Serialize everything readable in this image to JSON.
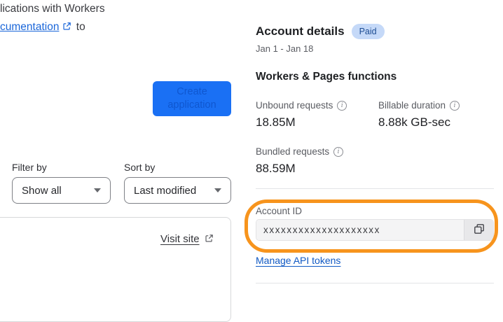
{
  "intro": {
    "line1": "lications with Workers",
    "doc_link_text": "cumentation",
    "line2_suffix": "to"
  },
  "create_button": {
    "label": "Create application"
  },
  "filters": {
    "filter_by_label": "Filter by",
    "filter_value": "Show all",
    "sort_by_label": "Sort by",
    "sort_value": "Last modified"
  },
  "card": {
    "visit_site_label": "Visit site"
  },
  "account": {
    "title": "Account details",
    "badge": "Paid",
    "date_range": "Jan 1 - Jan 18",
    "section_title": "Workers & Pages functions",
    "stats": [
      {
        "label": "Unbound requests",
        "value": "18.85M"
      },
      {
        "label": "Billable duration",
        "value": "8.88k GB-sec"
      },
      {
        "label": "Bundled requests",
        "value": "88.59M"
      }
    ],
    "account_id_label": "Account ID",
    "account_id_value": "xxxxxxxxxxxxxxxxxxxx",
    "manage_link_label": "Manage API tokens"
  },
  "icons": {
    "info": "i",
    "external_link": "external-link",
    "copy": "copy",
    "chevron_down": "chevron-down"
  },
  "colors": {
    "button_blue": "#1a70f4",
    "button_text_blue": "#0f57d0",
    "link_blue": "#1a66d9",
    "manage_link_blue": "#1059c4",
    "badge_bg": "#c5d9f8",
    "badge_text": "#1c4c92",
    "highlight_orange": "#f7941d",
    "input_bg": "#f4f4f5",
    "divider": "#e3e4e7"
  }
}
